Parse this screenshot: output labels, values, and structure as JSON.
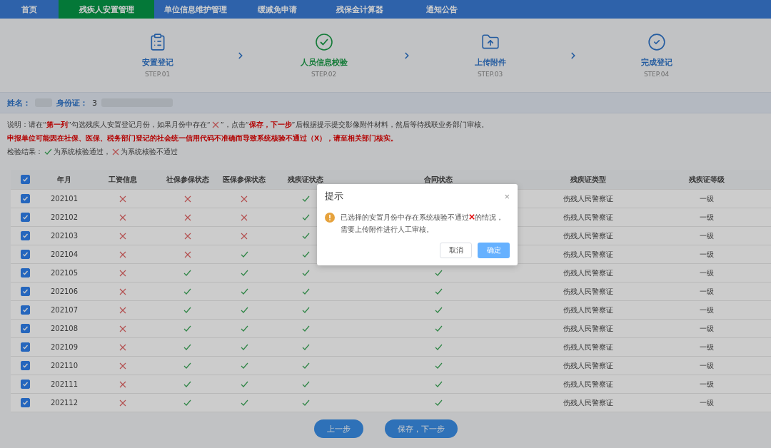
{
  "nav": {
    "tabs": [
      {
        "label": "首页",
        "selected": false
      },
      {
        "label": "残疾人安置管理",
        "selected": true
      },
      {
        "label": "单位信息维护管理",
        "selected": false
      },
      {
        "label": "缓减免申请",
        "selected": false
      },
      {
        "label": "残保金计算器",
        "selected": false
      },
      {
        "label": "通知公告",
        "selected": false
      }
    ]
  },
  "steps": [
    {
      "kind": "clipboard",
      "title": "安置登记",
      "step": "STEP.01",
      "selected": false
    },
    {
      "kind": "verify",
      "title": "人员信息校验",
      "step": "STEP.02",
      "selected": true
    },
    {
      "kind": "upload",
      "title": "上传附件",
      "step": "STEP.03",
      "selected": false
    },
    {
      "kind": "done",
      "title": "完成登记",
      "step": "STEP.04",
      "selected": false
    }
  ],
  "person": {
    "name_label": "姓名：",
    "id_label": "身份证：",
    "id_value": "3"
  },
  "notes": [
    [
      {
        "kind": "plain",
        "text": "说明：请在“"
      },
      {
        "kind": "emphasis",
        "text": "第一列"
      },
      {
        "kind": "plain",
        "text": "”勾选残疾人安置登记月份，如果月份中存在“"
      },
      {
        "kind": "cross"
      },
      {
        "kind": "plain",
        "text": "”，点击“"
      },
      {
        "kind": "emphasis",
        "text": "保存，下一步"
      },
      {
        "kind": "plain",
        "text": "”后根据提示提交影像附件材料，然后等待残联业务部门审核。"
      }
    ],
    [
      {
        "kind": "emphasis",
        "text": "申报单位可能因在社保、医保、税务部门登记的社会统一信用代码不准确而导致系统核验不通过（X），请至相关部门核实。"
      }
    ],
    [
      {
        "kind": "plain",
        "text": "检验结果："
      },
      {
        "kind": "check"
      },
      {
        "kind": "plain",
        "text": "为系统核验通过，"
      },
      {
        "kind": "cross"
      },
      {
        "kind": "plain",
        "text": "为系统核验不通过"
      }
    ]
  ],
  "table": {
    "all_checked": true,
    "columns": [
      "年月",
      "工资信息",
      "社保参保状态",
      "医保参保状态",
      "残疾证状态",
      "合同状态",
      "残疾证类型",
      "残疾证等级"
    ],
    "rows": [
      {
        "checked": true,
        "month": "202101",
        "checks": [
          {
            "passed": false
          },
          {
            "passed": false
          },
          {
            "passed": false
          },
          {
            "passed": true
          }
        ],
        "type": "伤残人民警察证",
        "level": "一级"
      },
      {
        "checked": true,
        "month": "202102",
        "checks": [
          {
            "passed": false
          },
          {
            "passed": false
          },
          {
            "passed": false
          },
          {
            "passed": true
          }
        ],
        "type": "伤残人民警察证",
        "level": "一级"
      },
      {
        "checked": true,
        "month": "202103",
        "checks": [
          {
            "passed": false
          },
          {
            "passed": false
          },
          {
            "passed": false
          },
          {
            "passed": true
          }
        ],
        "type": "伤残人民警察证",
        "level": "一级"
      },
      {
        "checked": true,
        "month": "202104",
        "checks": [
          {
            "passed": false
          },
          {
            "passed": false
          },
          {
            "passed": true
          },
          {
            "passed": true
          }
        ],
        "type": "伤残人民警察证",
        "level": "一级"
      },
      {
        "checked": true,
        "month": "202105",
        "checks": [
          {
            "passed": false
          },
          {
            "passed": true
          },
          {
            "passed": true
          },
          {
            "passed": true
          },
          {
            "passed": true
          }
        ],
        "type": "伤残人民警察证",
        "level": "一级"
      },
      {
        "checked": true,
        "month": "202106",
        "checks": [
          {
            "passed": false
          },
          {
            "passed": true
          },
          {
            "passed": true
          },
          {
            "passed": true
          },
          {
            "passed": true
          }
        ],
        "type": "伤残人民警察证",
        "level": "一级"
      },
      {
        "checked": true,
        "month": "202107",
        "checks": [
          {
            "passed": false
          },
          {
            "passed": true
          },
          {
            "passed": true
          },
          {
            "passed": true
          },
          {
            "passed": true
          }
        ],
        "type": "伤残人民警察证",
        "level": "一级"
      },
      {
        "checked": true,
        "month": "202108",
        "checks": [
          {
            "passed": false
          },
          {
            "passed": true
          },
          {
            "passed": true
          },
          {
            "passed": true
          },
          {
            "passed": true
          }
        ],
        "type": "伤残人民警察证",
        "level": "一级"
      },
      {
        "checked": true,
        "month": "202109",
        "checks": [
          {
            "passed": false
          },
          {
            "passed": true
          },
          {
            "passed": true
          },
          {
            "passed": true
          },
          {
            "passed": true
          }
        ],
        "type": "伤残人民警察证",
        "level": "一级"
      },
      {
        "checked": true,
        "month": "202110",
        "checks": [
          {
            "passed": false
          },
          {
            "passed": true
          },
          {
            "passed": true
          },
          {
            "passed": true
          },
          {
            "passed": true
          }
        ],
        "type": "伤残人民警察证",
        "level": "一级"
      },
      {
        "checked": true,
        "month": "202111",
        "checks": [
          {
            "passed": false
          },
          {
            "passed": true
          },
          {
            "passed": true
          },
          {
            "passed": true
          },
          {
            "passed": true
          }
        ],
        "type": "伤残人民警察证",
        "level": "一级"
      },
      {
        "checked": true,
        "month": "202112",
        "checks": [
          {
            "passed": false
          },
          {
            "passed": true
          },
          {
            "passed": true
          },
          {
            "passed": true
          },
          {
            "passed": true
          }
        ],
        "type": "伤残人民警察证",
        "level": "一级"
      }
    ]
  },
  "buttons": [
    "上一步",
    "保存，下一步"
  ],
  "dialog": {
    "title": "提示",
    "close": "×",
    "message": [
      {
        "kind": "plain",
        "text": "已选择的安置月份中存在系统核验不通过"
      },
      {
        "kind": "bold-cross"
      },
      {
        "kind": "plain",
        "text": "的情况，需要上传附件进行人工审核。"
      }
    ],
    "cancel": "取消",
    "confirm": "确定"
  }
}
